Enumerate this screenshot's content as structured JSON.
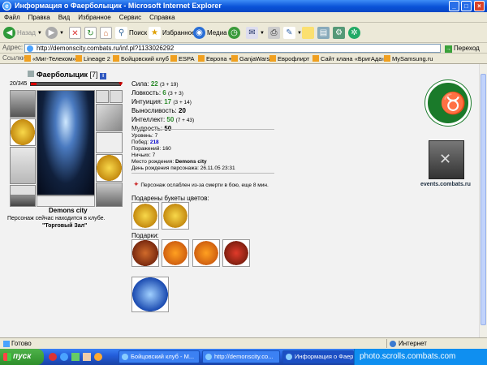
{
  "window": {
    "title": "Информация о Фаерболыцик - Microsoft Internet Explorer"
  },
  "menu": [
    "Файл",
    "Правка",
    "Вид",
    "Избранное",
    "Сервис",
    "Справка"
  ],
  "toolbar": {
    "back": "Назад",
    "search": "Поиск",
    "favorites": "Избранное",
    "media": "Медиа"
  },
  "address": {
    "label": "Адрес:",
    "url": "http://demonscity.combats.ru/inf.pl?1133026292",
    "go": "Переход"
  },
  "links": {
    "label": "Ссылки",
    "items": [
      "«Миг-Телеком»",
      "Lineage 2",
      "Бойцовский клуб",
      "ESPA",
      "Европа +",
      "GanjaWars",
      "Еврофлирт",
      "Сайт клана «БригАда»",
      "MySamsung.ru"
    ]
  },
  "character": {
    "name": "Фаерболыцик",
    "level": "[7]",
    "hp": "20/345",
    "city_label": "Demons city",
    "location_note": "Персонаж сейчас находится в клубе.",
    "room": "\"Торговый Зал\"",
    "stats": [
      {
        "label": "Сила:",
        "value": "22",
        "extra": "(3 + 19)"
      },
      {
        "label": "Ловкость:",
        "value": "6",
        "extra": "(3 + 3)"
      },
      {
        "label": "Интуиция:",
        "value": "17",
        "extra": "(3 + 14)"
      },
      {
        "label": "Выносливость:",
        "value": "20",
        "extra": ""
      },
      {
        "label": "Интеллект:",
        "value": "50",
        "extra": "(7 + 43)"
      },
      {
        "label": "Мудрость:",
        "value": "50",
        "extra": ""
      }
    ],
    "info": {
      "level_label": "Уровень:",
      "level_value": "7",
      "wins_label": "Побед:",
      "wins_value": "218",
      "losses_label": "Поражений:",
      "losses_value": "160",
      "draws_label": "Ничьих:",
      "draws_value": "7",
      "birthplace_label": "Место рождения:",
      "birthplace_value": "Demons city",
      "birthday_label": "День рождения персонажа:",
      "birthday_value": "26.11.05 23:31"
    },
    "weakened_note": "Персонаж ослаблен из-за смерти в бою, еще 8 мин.",
    "flowers_label": "Подарены букеты цветов:",
    "gifts_label": "Подарки:",
    "emblem_link": "events.combats.ru"
  },
  "status": {
    "left": "Готово",
    "zone": "Интернет"
  },
  "taskbar": {
    "start": "пуск",
    "tasks": [
      "Бойцовский клуб - M...",
      "http://demonscity.co...",
      "Информация о Фаер..."
    ],
    "watermark": "photo.scrolls.combats.com"
  },
  "colors": {
    "stat_green": "#2a8a2a",
    "wins_blue": "#0000cc",
    "emblem_green": "#1a7a2a"
  }
}
